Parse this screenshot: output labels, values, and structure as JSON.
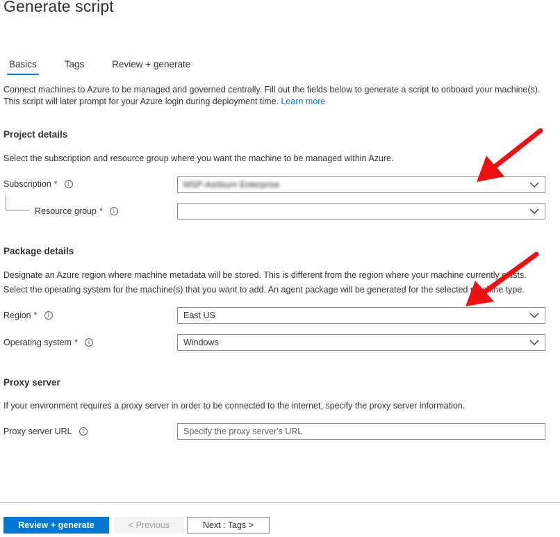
{
  "title": "Generate script",
  "tabs": [
    {
      "label": "Basics",
      "active": true
    },
    {
      "label": "Tags",
      "active": false
    },
    {
      "label": "Review + generate",
      "active": false
    }
  ],
  "intro": {
    "text": "Connect machines to Azure to be managed and governed centrally. Fill out the fields below to generate a script to onboard your machine(s). This script will later prompt for your Azure login during deployment time.",
    "link": "Learn more"
  },
  "project_details": {
    "heading": "Project details",
    "description": "Select the subscription and resource group where you want the machine to be managed within Azure.",
    "subscription": {
      "label": "Subscription",
      "required": "*",
      "value": "MSP-Ashburn Enterprise"
    },
    "resource_group": {
      "label": "Resource group",
      "required": "*",
      "value": ""
    }
  },
  "package_details": {
    "heading": "Package details",
    "description_1": "Designate an Azure region where machine metadata will be stored. This is different from the region where your machine currently exists.",
    "description_2": "Select the operating system for the machine(s) that you want to add. An agent package will be generated for the selected machine type.",
    "region": {
      "label": "Region",
      "required": "*",
      "value": "East US"
    },
    "os": {
      "label": "Operating system",
      "required": "*",
      "value": "Windows"
    }
  },
  "proxy": {
    "heading": "Proxy server",
    "description": "If your environment requires a proxy server in order to be connected to the internet, specify the proxy server information.",
    "url_label": "Proxy server URL",
    "url_placeholder": "Specify the proxy server's URL"
  },
  "footer": {
    "review_generate": "Review + generate",
    "previous": "< Previous",
    "next": "Next : Tags >"
  },
  "colors": {
    "accent": "#0078d4",
    "required": "#a4262c",
    "annotation_arrow": "#ee1111"
  },
  "icons": {
    "info": "info-icon",
    "chevron": "chevron-down-icon",
    "arrow": "red-arrow-annotation"
  }
}
